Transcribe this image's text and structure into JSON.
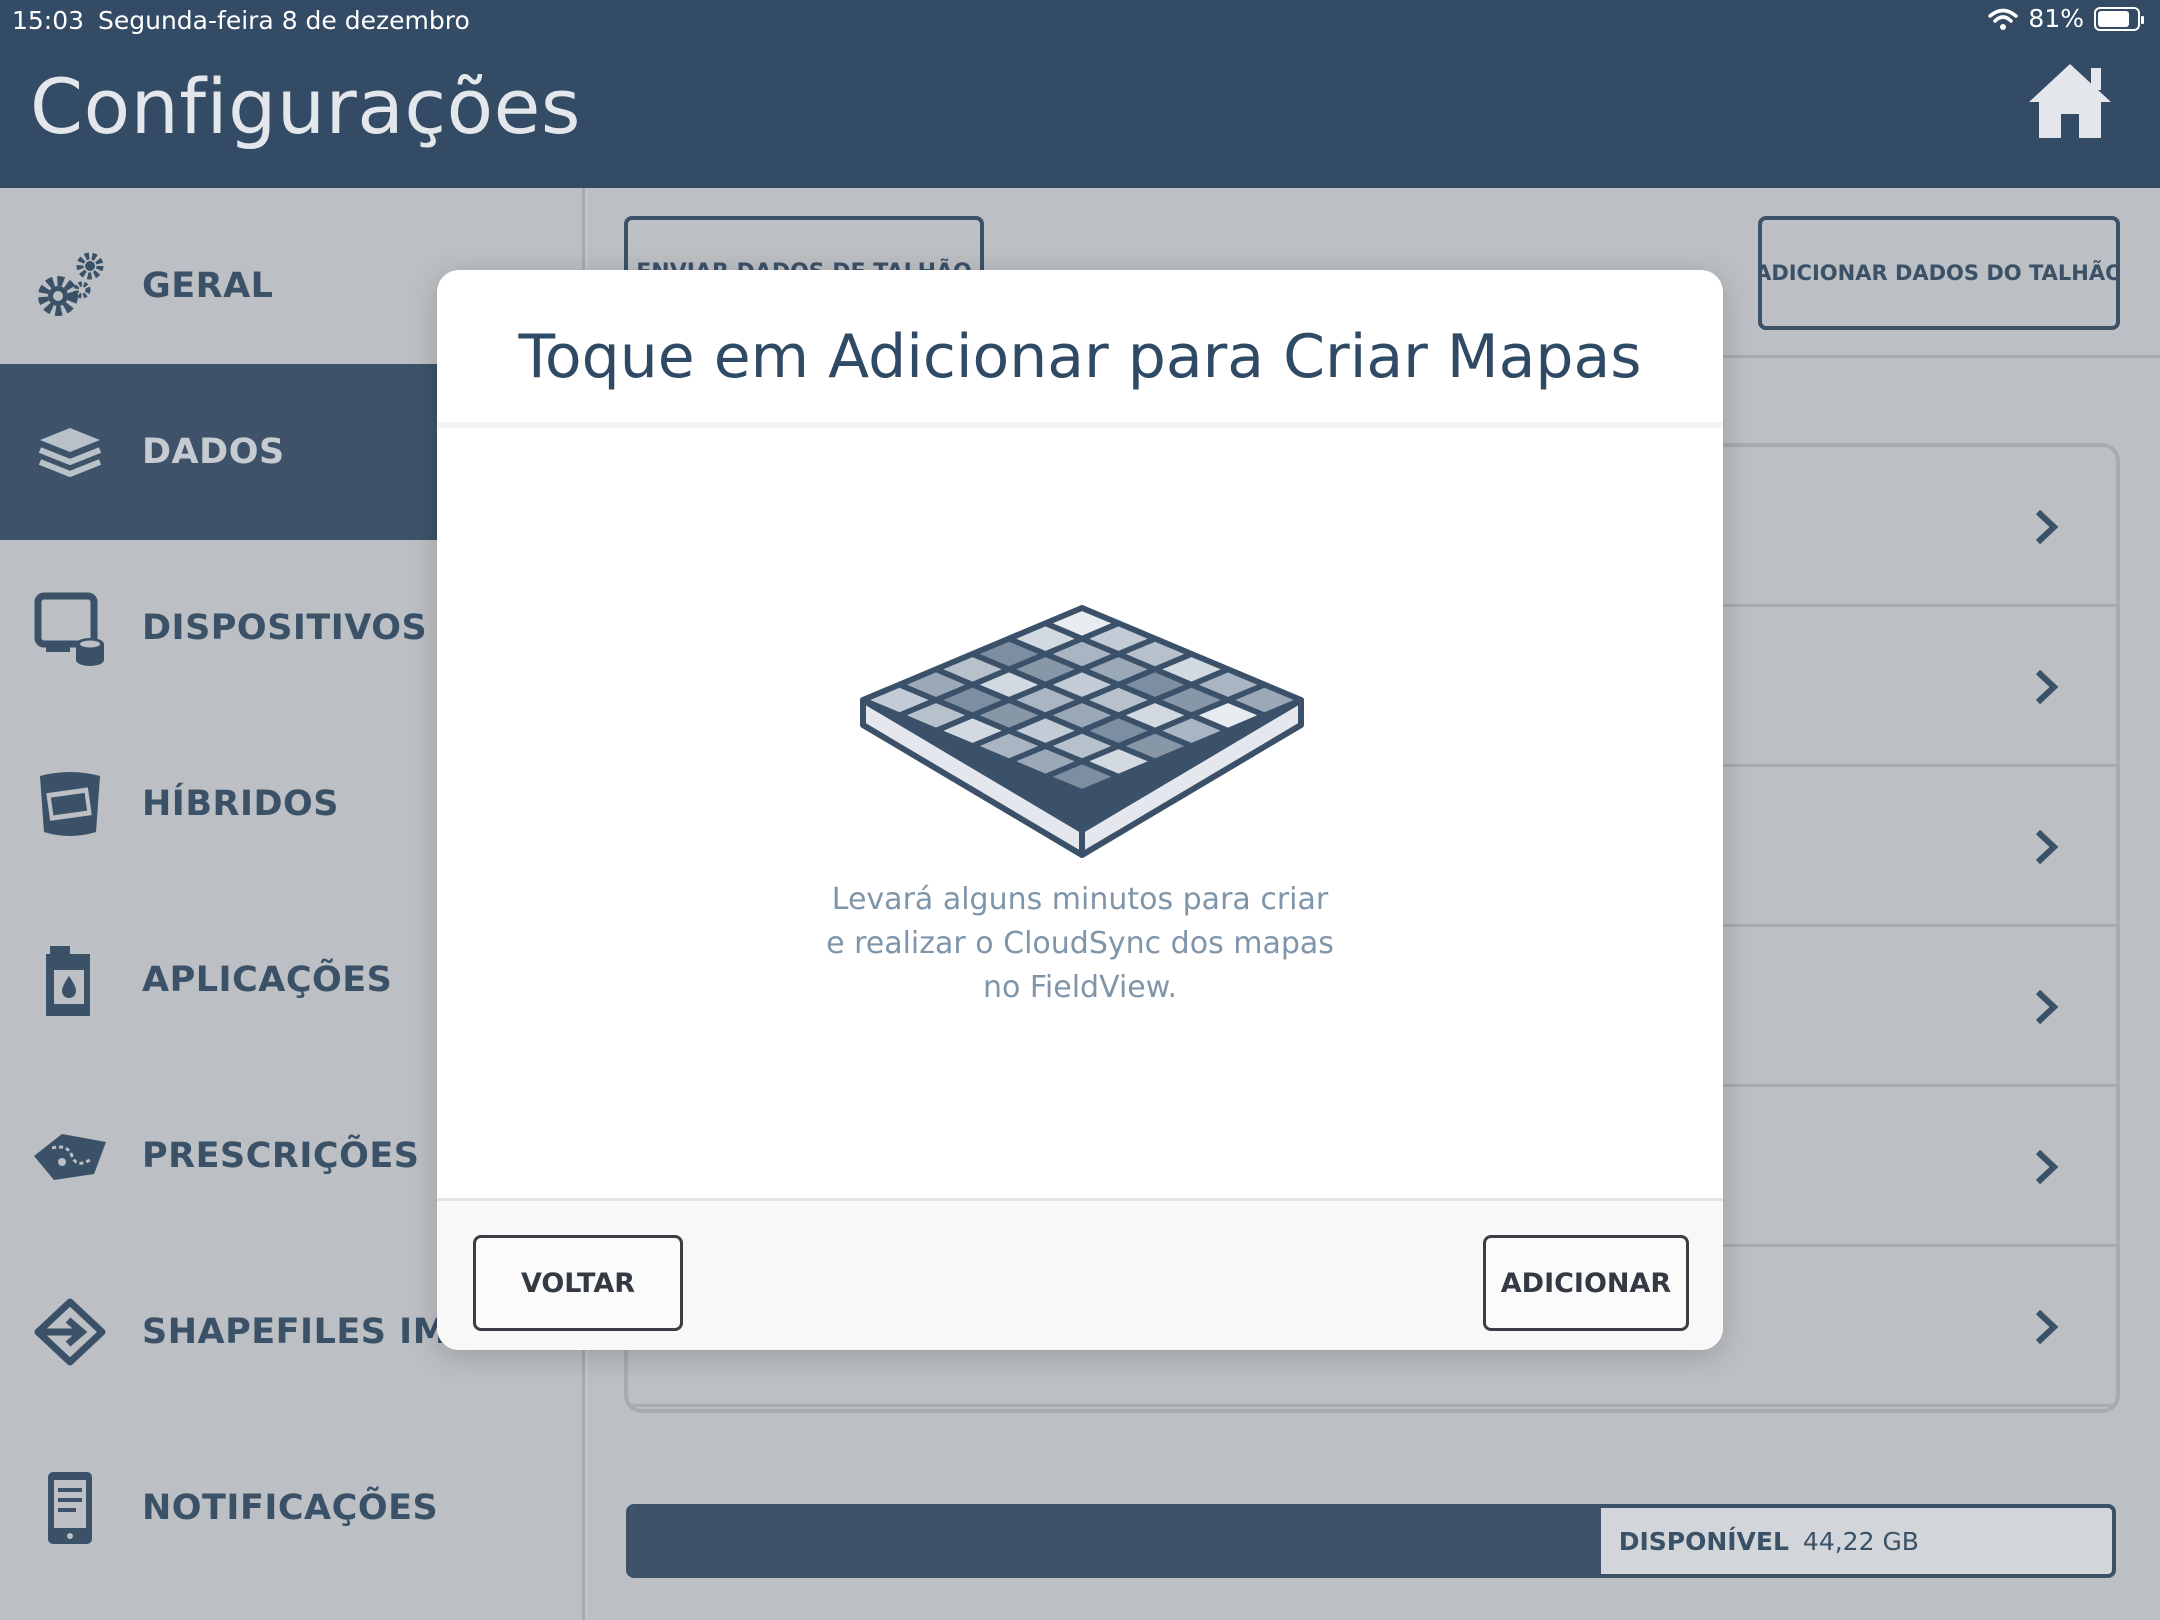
{
  "status_bar": {
    "time": "15:03",
    "date": "Segunda-feira 8 de dezembro",
    "battery": "81%",
    "battery_level": 0.81
  },
  "header": {
    "title": "Configurações",
    "home_icon": "home-icon"
  },
  "sidebar": {
    "items": [
      {
        "label": "GERAL",
        "icon": "gears-icon",
        "active": false
      },
      {
        "label": "DADOS",
        "icon": "layers-icon",
        "active": true
      },
      {
        "label": "DISPOSITIVOS",
        "icon": "device-icon",
        "active": false
      },
      {
        "label": "HÍBRIDOS",
        "icon": "seed-bag-icon",
        "active": false
      },
      {
        "label": "APLICAÇÕES",
        "icon": "jerrycan-icon",
        "active": false
      },
      {
        "label": "PRESCRIÇÕES",
        "icon": "prescription-map-icon",
        "active": false
      },
      {
        "label": "SHAPEFILES IMPOR",
        "icon": "import-arrow-icon",
        "active": false
      },
      {
        "label": "NOTIFICAÇÕES",
        "icon": "phone-notification-icon",
        "active": false
      }
    ]
  },
  "main": {
    "send_button": "ENVIAR DADOS DE TALHÃO",
    "add_data_button": "ADICIONAR DADOS DO TALHÃO",
    "rows_icon": "chevron-right-icon",
    "storage": {
      "used_fraction": 0.655,
      "available_label": "DISPONÍVEL",
      "available_value": "44,22 GB"
    }
  },
  "modal": {
    "title": "Toque em Adicionar para Criar Mapas",
    "illustration": "grid-map-icon",
    "message": "Levará alguns minutos para criar e realizar o CloudSync dos mapas no FieldView.",
    "back_button": "VOLTAR",
    "add_button": "ADICIONAR"
  },
  "colors": {
    "header_bg": "#334b64",
    "accent": "#2f4a64",
    "muted_text": "#7f95aa"
  }
}
